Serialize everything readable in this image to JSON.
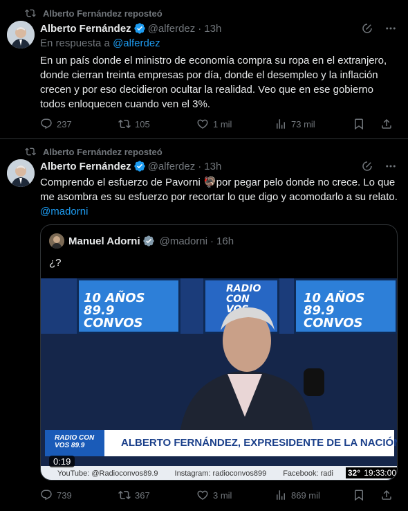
{
  "tweets": [
    {
      "repost_label": "Alberto Fernández reposteó",
      "name": "Alberto Fernández",
      "handle": "@alferdez",
      "time": "13h",
      "reply_prefix": "En respuesta a",
      "reply_handle": "@alferdez",
      "text": "En un país donde el ministro de economía compra su ropa en el extranjero, donde cierran treinta empresas por día, donde el desempleo y la inflación crecen y por eso decidieron ocultar la realidad. Veo que en ese gobierno todos enloquecen cuando ven el 3%.",
      "replies": "237",
      "reposts": "105",
      "likes": "1 mil",
      "views": "73 mil"
    },
    {
      "repost_label": "Alberto Fernández reposteó",
      "name": "Alberto Fernández",
      "handle": "@alferdez",
      "time": "13h",
      "text_part1": "Comprendo el esfuerzo de Pavorni ",
      "text_emoji": "🦃",
      "text_part2": "por pegar pelo donde no crece. Lo que me asombra es su esfuerzo por recortar lo que digo y acomodarlo a su relato. ",
      "text_mention": "@madorni",
      "replies": "739",
      "reposts": "367",
      "likes": "3 mil",
      "views": "869 mil",
      "quote": {
        "name": "Manuel Adorni",
        "handle": "@madorni",
        "time": "16h",
        "text": "¿?",
        "video": {
          "screen_left": "10 AÑOS 89.9 CONVOS",
          "screen_center": "RADIO CON VOS",
          "screen_right": "10 AÑOS 89.9 CONVOS",
          "lower_logo": "RADIO CON VOS 89.9",
          "lower_title": "ALBERTO FERNÁNDEZ, EXPRESIDENTE DE LA NACIÓN ARGENTINA",
          "ticker_youtube": "YouTube: @Radioconvos89.9",
          "ticker_instagram": "Instagram: radioconvos899",
          "ticker_facebook": "Facebook: radi",
          "temperature": "32°",
          "clock": "19:33:00",
          "duration": "0:19"
        }
      }
    }
  ],
  "colors": {
    "accent": "#1d9bf0",
    "muted": "#71767b",
    "background": "#000000",
    "border": "#2f3336"
  },
  "icons": [
    "repost-icon",
    "verified-badge-icon",
    "grok-icon",
    "more-icon",
    "reply-icon",
    "like-icon",
    "views-icon",
    "bookmark-icon",
    "share-icon"
  ]
}
